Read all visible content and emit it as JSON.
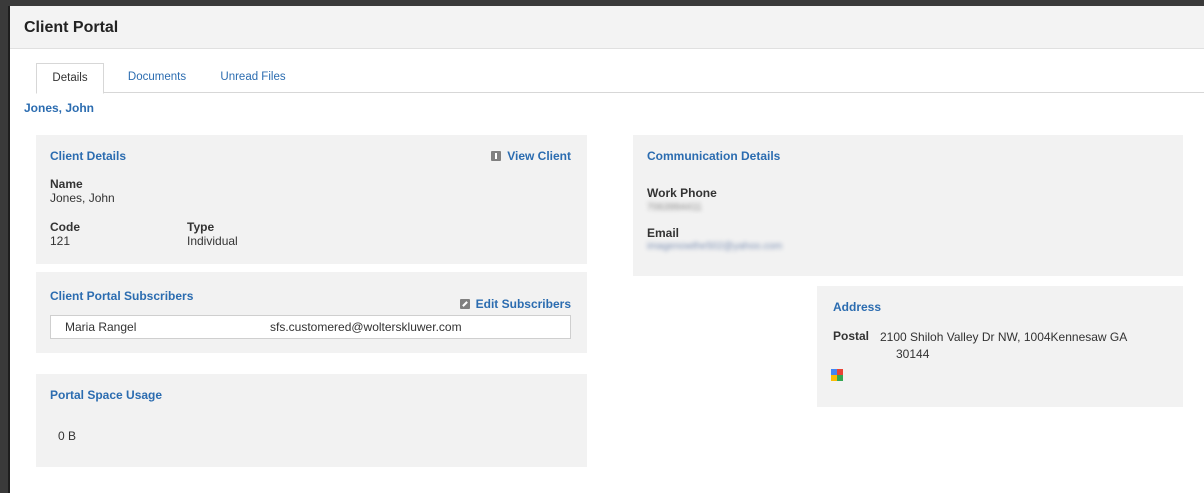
{
  "header": {
    "title": "Client Portal"
  },
  "tabs": [
    {
      "label": "Details",
      "active": true
    },
    {
      "label": "Documents",
      "active": false
    },
    {
      "label": "Unread Files",
      "active": false
    }
  ],
  "client": {
    "name": "Jones, John"
  },
  "client_details": {
    "title": "Client Details",
    "view_link": "View Client",
    "name_label": "Name",
    "name_value": "Jones, John",
    "code_label": "Code",
    "code_value": "121",
    "type_label": "Type",
    "type_value": "Individual"
  },
  "subscribers": {
    "title": "Client Portal Subscribers",
    "edit_link": "Edit Subscribers",
    "rows": [
      {
        "name": "Maria Rangel",
        "email": "sfs.customered@wolterskluwer.com"
      }
    ]
  },
  "space_usage": {
    "title": "Portal Space Usage",
    "value": "0 B"
  },
  "communication": {
    "title": "Communication Details",
    "work_phone_label": "Work Phone",
    "work_phone_value": "7063994411",
    "email_label": "Email",
    "email_value": "imagenowthe502@yahoo.com"
  },
  "address": {
    "title": "Address",
    "postal_label": "Postal",
    "postal_line1": "2100 Shiloh Valley Dr NW, 1004Kennesaw GA",
    "postal_line2": "30144",
    "map_icon": "map-icon"
  },
  "colors": {
    "link": "#2b6cb0",
    "panel": "#f2f2f2",
    "header": "#f3f3f3"
  }
}
